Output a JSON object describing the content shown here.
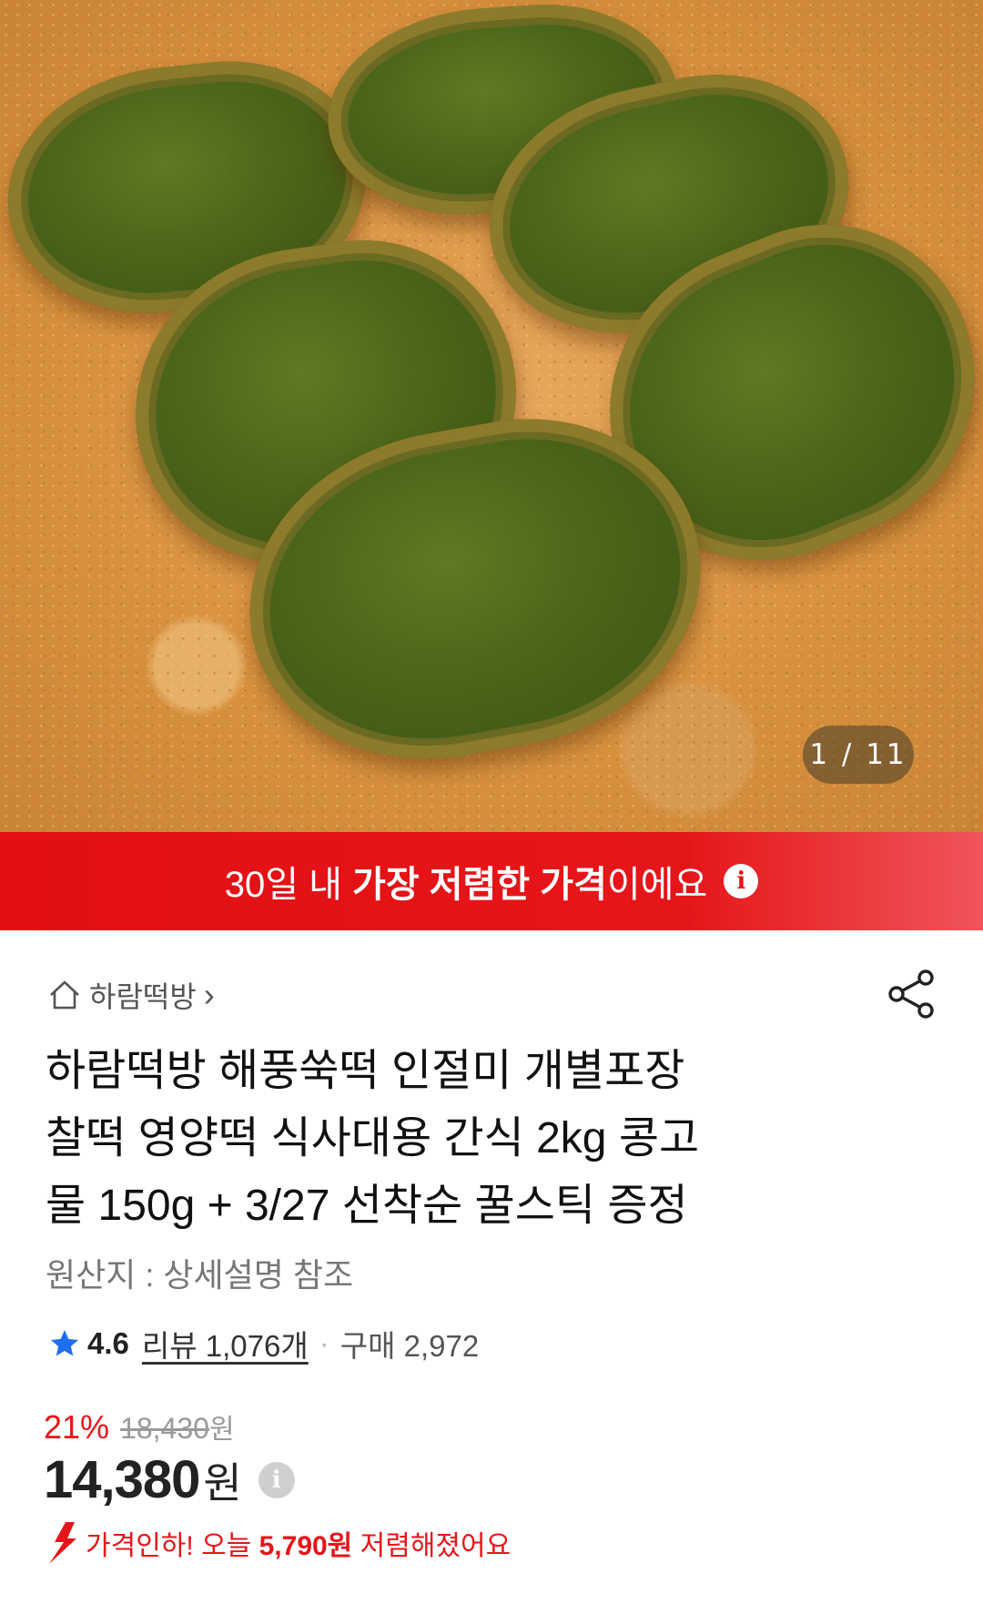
{
  "gallery": {
    "counter": "1 / 11"
  },
  "banner": {
    "prefix": "30일 내 ",
    "highlight": "가장 저렴한 가격",
    "suffix": "이에요",
    "info_icon": "info-icon",
    "color": "#e5161a"
  },
  "seller": {
    "name": "하람떡방",
    "chevron": "›"
  },
  "product": {
    "title_lines": [
      "하람떡방 해풍쑥떡 인절미 개별포장",
      "찰떡 영양떡 식사대용 간식 2kg 콩고",
      "물 150g + 3/27 선착순 꿀스틱 증정"
    ],
    "origin": "원산지 : 상세설명 참조"
  },
  "rating": {
    "score": "4.6",
    "reviews": "리뷰 1,076개",
    "separator": "·",
    "purchases": "구매 2,972",
    "star_color": "#1e6ff0"
  },
  "price": {
    "discount": "21%",
    "original": "18,430",
    "original_unit": "원",
    "current": "14,380",
    "unit": "원",
    "drop_prefix": "가격인하! 오늘 ",
    "drop_amount": "5,790원",
    "drop_suffix": " 저렴해졌어요"
  }
}
